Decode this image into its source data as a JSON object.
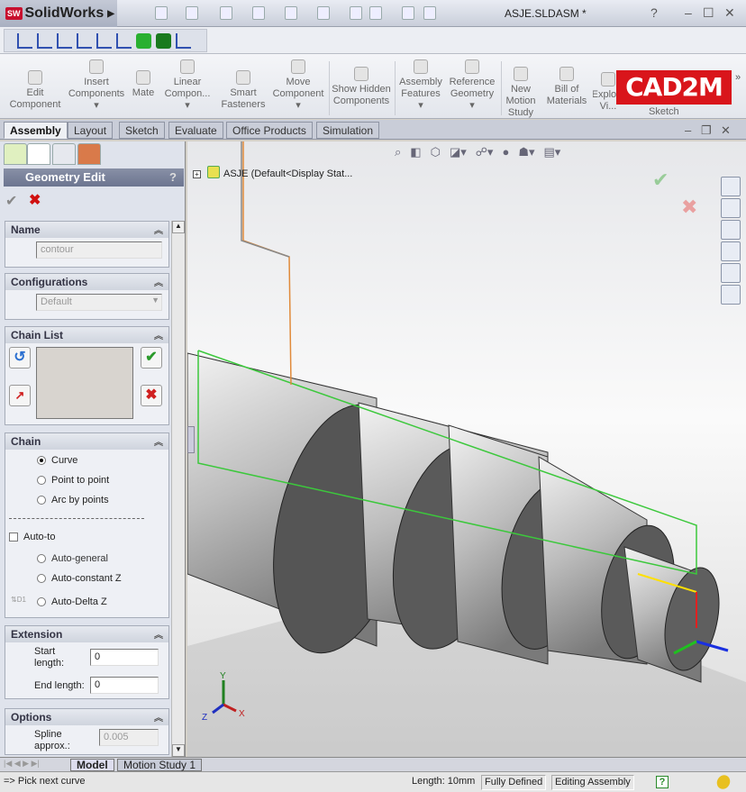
{
  "app": {
    "name": "SolidWorks",
    "logo_badge": "SW",
    "document_title": "ASJE.SLDASM *"
  },
  "commands": [
    {
      "label": "Edit Component"
    },
    {
      "label": "Insert Components"
    },
    {
      "label": "Mate"
    },
    {
      "label": "Linear Compon..."
    },
    {
      "label": "Smart Fasteners"
    },
    {
      "label": "Move Component"
    },
    {
      "label": "Show Hidden Components"
    },
    {
      "label": "Assembly Features"
    },
    {
      "label": "Reference Geometry"
    },
    {
      "label": "New Motion Study"
    },
    {
      "label": "Bill of Materials"
    },
    {
      "label": "Explo... Vi..."
    }
  ],
  "watermark": "CAD2M",
  "sketch_label": "Sketch",
  "tabs": [
    "Assembly",
    "Layout",
    "Sketch",
    "Evaluate",
    "Office Products",
    "Simulation"
  ],
  "active_tab": "Assembly",
  "tree": {
    "root": "ASJE  (Default<Display Stat..."
  },
  "pm": {
    "title": "Geometry Edit",
    "help": "?",
    "name": {
      "header": "Name",
      "value": "contour"
    },
    "configurations": {
      "header": "Configurations",
      "value": "Default"
    },
    "chain_list": {
      "header": "Chain List"
    },
    "chain": {
      "header": "Chain",
      "options": [
        "Curve",
        "Point to point",
        "Arc by points"
      ],
      "selected": "Curve",
      "auto_to": "Auto-to",
      "auto_options": [
        "Auto-general",
        "Auto-constant Z",
        "Auto-Delta Z"
      ],
      "auto_to_checked": false
    },
    "extension": {
      "header": "Extension",
      "start_label": "Start length:",
      "start_value": "0",
      "end_label": "End length:",
      "end_value": "0"
    },
    "options": {
      "header": "Options",
      "spline_label": "Spline approx.:",
      "spline_value": "0.005"
    }
  },
  "triad": {
    "x": "X",
    "y": "Y",
    "z": "Z"
  },
  "bottom_tabs": [
    "Model",
    "Motion Study 1"
  ],
  "status": {
    "prompt": "=> Pick next curve",
    "length": "Length: 10mm",
    "defined": "Fully Defined",
    "mode": "Editing Assembly",
    "help": "?"
  },
  "colors": {
    "profile": "#3cc83c",
    "sketch": "#e08a3a",
    "shaft_face": "#5f5f5f"
  }
}
